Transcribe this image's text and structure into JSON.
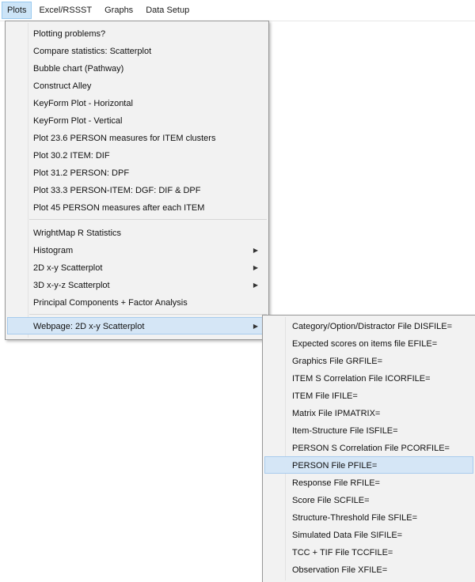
{
  "menubar": {
    "items": [
      "Plots",
      "Excel/RSSST",
      "Graphs",
      "Data Setup"
    ]
  },
  "plots_menu": {
    "group1": [
      "Plotting problems?",
      "Compare statistics: Scatterplot",
      "Bubble chart (Pathway)",
      "Construct Alley",
      "KeyForm Plot - Horizontal",
      "KeyForm Plot - Vertical",
      "Plot 23.6 PERSON measures for ITEM clusters",
      "Plot 30.2 ITEM: DIF",
      "Plot 31.2 PERSON: DPF",
      "Plot 33.3 PERSON-ITEM: DGF: DIF & DPF",
      "Plot 45 PERSON measures after each ITEM"
    ],
    "group2": [
      "WrightMap R Statistics",
      "Histogram",
      "2D x-y Scatterplot",
      "3D x-y-z Scatterplot",
      "Principal Components + Factor Analysis"
    ],
    "group3": [
      "Webpage: 2D x-y Scatterplot"
    ]
  },
  "webpage_submenu": {
    "items": [
      "Category/Option/Distractor File DISFILE=",
      "Expected scores on items file EFILE=",
      "Graphics File GRFILE=",
      "ITEM S Correlation File ICORFILE=",
      "ITEM File IFILE=",
      "Matrix File IPMATRIX=",
      "Item-Structure File ISFILE=",
      "PERSON S Correlation File PCORFILE=",
      "PERSON File PFILE=",
      "Response File RFILE=",
      "Score File SCFILE=",
      "Structure-Threshold File SFILE=",
      "Simulated Data File SIFILE=",
      "TCC + TIF File TCCFILE=",
      "Observation File XFILE="
    ]
  },
  "icons": {
    "submenu_arrow": "chevron-right-icon"
  },
  "colors": {
    "menu_bg": "#f2f2f2",
    "highlight_bg": "#d5e6f6",
    "highlight_border": "#a8cbed",
    "menubar_active": "#cce4f7"
  }
}
